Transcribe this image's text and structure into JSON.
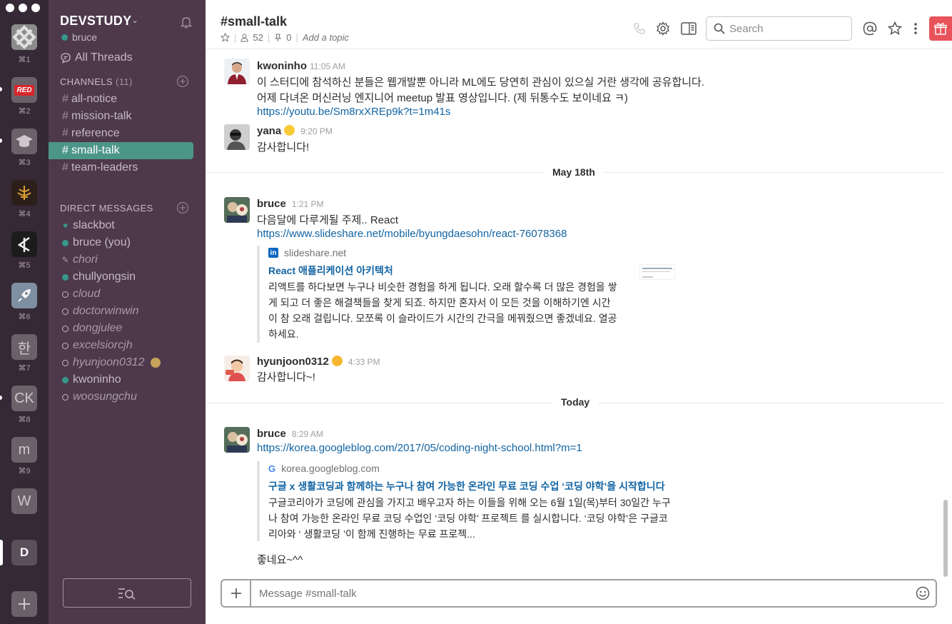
{
  "teams": [
    {
      "key": "⌘1",
      "label": ""
    },
    {
      "key": "⌘2",
      "label": "RED"
    },
    {
      "key": "⌘3",
      "label": ""
    },
    {
      "key": "⌘4",
      "label": ""
    },
    {
      "key": "⌘5",
      "label": ""
    },
    {
      "key": "⌘6",
      "label": ""
    },
    {
      "key": "⌘7",
      "label": "한"
    },
    {
      "key": "⌘8",
      "label": "CK"
    },
    {
      "key": "⌘9",
      "label": "m"
    },
    {
      "key": "",
      "label": "W"
    },
    {
      "key": "",
      "label": "D"
    }
  ],
  "sidebar": {
    "team_name": "DEVSTUDY",
    "user": "bruce",
    "all_threads": "All Threads",
    "channels_header": "CHANNELS",
    "channels_count": "(11)",
    "channels": [
      {
        "name": "all-notice",
        "active": false
      },
      {
        "name": "mission-talk",
        "active": false
      },
      {
        "name": "reference",
        "active": false
      },
      {
        "name": "small-talk",
        "active": true
      },
      {
        "name": "team-leaders",
        "active": false
      }
    ],
    "dm_header": "DIRECT MESSAGES",
    "dms": [
      {
        "name": "slackbot",
        "status": "bot"
      },
      {
        "name": "bruce (you)",
        "status": "online"
      },
      {
        "name": "chori",
        "status": "pencil"
      },
      {
        "name": "chullyongsin",
        "status": "online"
      },
      {
        "name": "cloud",
        "status": "away"
      },
      {
        "name": "doctorwinwin",
        "status": "away"
      },
      {
        "name": "dongjulee",
        "status": "away"
      },
      {
        "name": "excelsiorcjh",
        "status": "away"
      },
      {
        "name": "hyunjoon0312",
        "status": "away"
      },
      {
        "name": "kwoninho",
        "status": "online-special"
      },
      {
        "name": "woosungchu",
        "status": "away"
      }
    ]
  },
  "header": {
    "channel": "#small-talk",
    "members": "52",
    "pins": "0",
    "topic": "Add a topic",
    "search_placeholder": "Search"
  },
  "messages": {
    "m1": {
      "sender": "kwoninho",
      "time": "11:05 AM",
      "lines": [
        "이 스터디에 참석하신 분들은 웹개발뿐 아니라 ML에도 당연히 관심이 있으실 거란 생각에 공유합니다.",
        "어제 다녀온 머신러닝 엔지니어 meetup 발표 영상입니다. (제 뒤통수도 보이네요 ㅋ)"
      ],
      "link": "https://youtu.be/Sm8rxXREp9k?t=1m41s"
    },
    "m2": {
      "sender": "yana",
      "time": "9:20 PM",
      "text": "감사합니다!"
    },
    "divider1": "May 18th",
    "m3": {
      "sender": "bruce",
      "time": "1:21 PM",
      "text": "다음달에 다루게될 주제.. React",
      "link": "https://www.slideshare.net/mobile/byungdaesohn/react-76078368",
      "unfurl": {
        "site": "slideshare.net",
        "title": "React 애플리케이션 아키텍처",
        "desc": [
          "리액트를 하다보면 누구나 비슷한 경험을 하게 됩니다. 오래 할수록 더 많은 경험을 쌓",
          "게 되고 더 좋은 해결책들을 찾게 되죠. 하지만 혼자서 이 모든 것을 이해하기엔 시간",
          "이 참 오래 걸립니다. 모쪼록 이 슬라이드가 시간의 간극을 메꿔줬으면 좋겠네요. 열공",
          "하세요."
        ]
      }
    },
    "m4": {
      "sender": "hyunjoon0312",
      "time": "4:33 PM",
      "text": "감사합니다~!"
    },
    "divider2": "Today",
    "m5": {
      "sender": "bruce",
      "time": "8:29 AM",
      "link": "https://korea.googleblog.com/2017/05/coding-night-school.html?m=1",
      "unfurl": {
        "site": "korea.googleblog.com",
        "title": "구글 x 생활코딩과 함께하는 누구나 참여 가능한 온라인 무료 코딩 수업 ‘코딩 야학’을 시작합니다",
        "desc": [
          "구글코리아가 코딩에 관심을 가지고 배우고자 하는 이들을 위해 오는 6월 1일(목)부터 30일간 누구",
          "나 참여 가능한 온라인 무료 코딩 수업인 ‘코딩 야학’ 프로젝트 를 실시합니다. ‘코딩 야학’은 구글코",
          "리아와 ‘ 생활코딩 ’이 함께 진행하는 무료 프로젝..."
        ]
      },
      "followup": "좋네요~^^"
    }
  },
  "composer": {
    "placeholder": "Message #small-talk"
  },
  "colors": {
    "sidebar": "#4d394b",
    "rail": "#362936",
    "active_channel": "#4c9689",
    "link": "#1264a3",
    "gift": "#e8525a"
  }
}
